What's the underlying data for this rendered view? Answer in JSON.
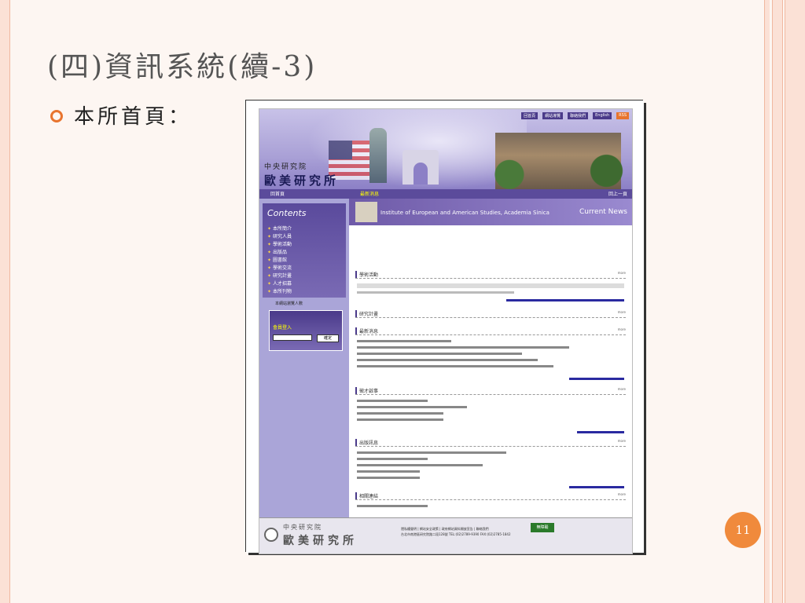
{
  "slide": {
    "title": "(四)資訊系統(續-3)",
    "bullet": "本所首頁：",
    "page_number": "11"
  },
  "site": {
    "org": "中央研究院",
    "name": "歐美研究所",
    "top_nav": [
      "回首頁",
      "網站導覽",
      "聯絡我們",
      "English",
      "RSS"
    ],
    "home_label": "回首頁",
    "page_label": "最新消息",
    "back_label": "回上一頁",
    "sidebar_title": "Contents",
    "menu": [
      "本所簡介",
      "研究人員",
      "學術活動",
      "出版品",
      "圖書館",
      "學術交流",
      "研究計畫",
      "人才招募",
      "本所刊物"
    ],
    "counter": "本網站瀏覽人數",
    "login_title": "會員登入",
    "login_button": "確定",
    "header_text": "Institute of European and American Studies, Academia Sinica",
    "header_current": "Current News",
    "sections": [
      {
        "title": "學術活動",
        "more": "more"
      },
      {
        "title": "研究計畫",
        "more": "more"
      },
      {
        "title": "最新消息",
        "more": "more"
      },
      {
        "title": "徵才啟事",
        "more": "more"
      },
      {
        "title": "出版訊息",
        "more": "more"
      },
      {
        "title": "相關連結",
        "more": "more"
      }
    ],
    "footer_org": "中央研究院",
    "footer_name": "歐美研究所",
    "footer_links": "隱私權聲明 | 網站安全政策 | 政府網站資料開放宣告 | 聯絡我們",
    "footer_addr": "台北市南港區研究院路二段128號 TEL:(02)2789-9390 FAX:(02)2785-1842",
    "badge": "無障礙"
  }
}
